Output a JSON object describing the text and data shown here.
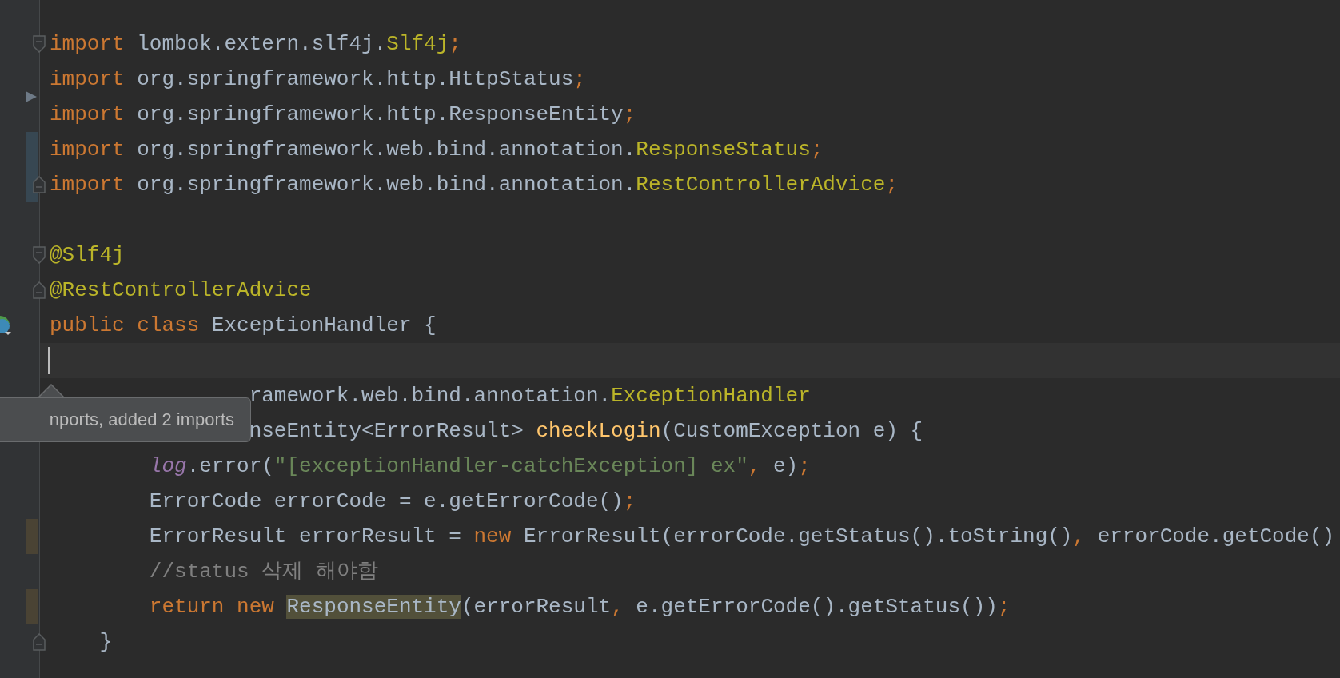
{
  "editor": {
    "blocks": [
      {
        "lines": [
          {
            "tokens": [
              {
                "kind": "keyword",
                "text": "import "
              },
              {
                "kind": "plain",
                "text": "lombok.extern.slf4j."
              },
              {
                "kind": "annotation",
                "text": "Slf4j"
              },
              {
                "kind": "punct",
                "text": ";"
              }
            ],
            "fold_start": true
          },
          {
            "tokens": [
              {
                "kind": "keyword",
                "text": "import "
              },
              {
                "kind": "plain",
                "text": "org.springframework.http.HttpStatus"
              },
              {
                "kind": "punct",
                "text": ";"
              }
            ],
            "run_marker": true
          },
          {
            "tokens": [
              {
                "kind": "keyword",
                "text": "import "
              },
              {
                "kind": "plain",
                "text": "org.springframework.http.ResponseEntity"
              },
              {
                "kind": "punct",
                "text": ";"
              }
            ]
          },
          {
            "tokens": [
              {
                "kind": "keyword",
                "text": "import "
              },
              {
                "kind": "plain",
                "text": "org.springframework.web.bind.annotation."
              },
              {
                "kind": "annotation",
                "text": "ResponseStatus"
              },
              {
                "kind": "punct",
                "text": ";"
              }
            ],
            "vcs_modified": true
          },
          {
            "tokens": [
              {
                "kind": "keyword",
                "text": "import "
              },
              {
                "kind": "plain",
                "text": "org.springframework.web.bind.annotation."
              },
              {
                "kind": "annotation",
                "text": "RestControllerAdvice"
              },
              {
                "kind": "punct",
                "text": ";"
              }
            ],
            "fold_end": true,
            "vcs_modified": true
          }
        ]
      },
      {
        "lines": [
          {
            "tokens": [
              {
                "kind": "annotation",
                "text": "@Slf4j"
              }
            ],
            "fold_start": true
          },
          {
            "tokens": [
              {
                "kind": "annotation",
                "text": "@RestControllerAdvice"
              }
            ],
            "fold_end": true
          },
          {
            "tokens": [
              {
                "kind": "keyword",
                "text": "public class "
              },
              {
                "kind": "plain",
                "text": "ExceptionHandler {"
              }
            ],
            "class_marker": true
          },
          {
            "current": true
          },
          {
            "tokens": [
              {
                "kind": "plain",
                "text": "                ramework.web.bind.annotation."
              },
              {
                "kind": "annotation",
                "text": "ExceptionHandler"
              }
            ]
          },
          {
            "tokens": [
              {
                "kind": "plain",
                "text": "                nseEntity<ErrorResult> "
              },
              {
                "kind": "method",
                "text": "checkLogin"
              },
              {
                "kind": "plain",
                "text": "(CustomException e) {"
              }
            ]
          },
          {
            "tokens": [
              {
                "kind": "field",
                "text": "        log"
              },
              {
                "kind": "plain",
                "text": ".error("
              },
              {
                "kind": "string",
                "text": "\"[exceptionHandler-catchException] ex\""
              },
              {
                "kind": "punct",
                "text": ", "
              },
              {
                "kind": "plain",
                "text": "e)"
              },
              {
                "kind": "punct",
                "text": ";"
              }
            ]
          },
          {
            "tokens": [
              {
                "kind": "plain",
                "text": "        ErrorCode errorCode = e.getErrorCode()"
              },
              {
                "kind": "punct",
                "text": ";"
              }
            ]
          },
          {
            "tokens": [
              {
                "kind": "plain",
                "text": "        ErrorResult errorResult = "
              },
              {
                "kind": "keyword",
                "text": "new "
              },
              {
                "kind": "plain",
                "text": "ErrorResult(errorCode.getStatus().toString()"
              },
              {
                "kind": "punct",
                "text": ", "
              },
              {
                "kind": "plain",
                "text": "errorCode.getCode()"
              }
            ],
            "vcs_edited": true
          },
          {
            "tokens": [
              {
                "kind": "comment",
                "text": "        //status 삭제 해야함"
              }
            ]
          },
          {
            "tokens": [
              {
                "kind": "keyword",
                "text": "        return new "
              },
              {
                "kind": "plain",
                "text": "ResponseEntity",
                "highlight": true
              },
              {
                "kind": "plain",
                "text": "(errorResult"
              },
              {
                "kind": "punct",
                "text": ", "
              },
              {
                "kind": "plain",
                "text": "e.getErrorCode().getStatus())"
              },
              {
                "kind": "punct",
                "text": ";"
              }
            ],
            "vcs_edited": true
          },
          {
            "tokens": [
              {
                "kind": "plain",
                "text": "    }"
              }
            ],
            "fold_end": true
          }
        ]
      }
    ]
  },
  "tooltip": {
    "text": "nports, added 2 imports"
  }
}
